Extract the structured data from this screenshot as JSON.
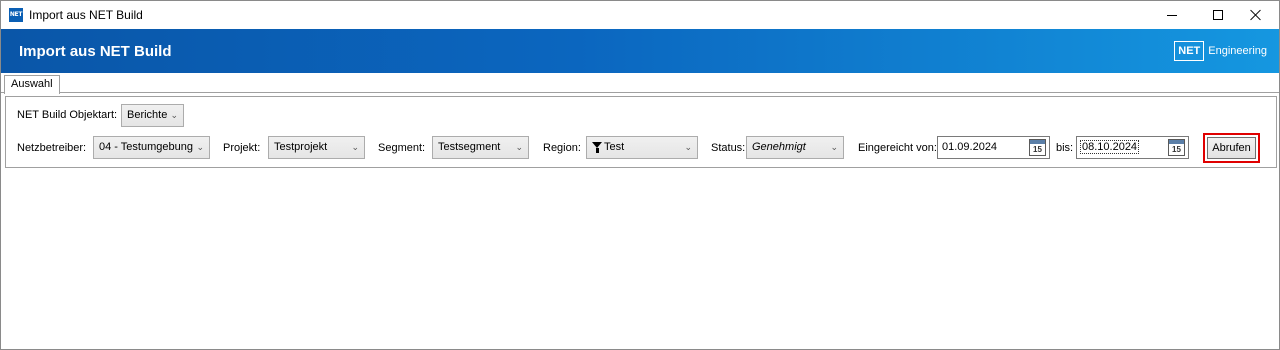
{
  "window": {
    "title": "Import aus NET Build",
    "icon_text": "NET"
  },
  "banner": {
    "title": "Import aus NET Build",
    "brand_logo": "NET",
    "brand_text": "Engineering"
  },
  "tabs": [
    {
      "label": "Auswahl"
    }
  ],
  "form": {
    "objektart": {
      "label": "NET Build Objektart:",
      "value": "Berichte"
    },
    "netzbetreiber": {
      "label": "Netzbetreiber:",
      "value": "04 - Testumgebung"
    },
    "projekt": {
      "label": "Projekt:",
      "value": "Testprojekt"
    },
    "segment": {
      "label": "Segment:",
      "value": "Testsegment"
    },
    "region": {
      "label": "Region:",
      "value": "Test"
    },
    "status": {
      "label": "Status:",
      "value": "Genehmigt"
    },
    "eingereicht_von": {
      "label": "Eingereicht von:",
      "value": "01.09.2024",
      "cal_number": "15"
    },
    "bis": {
      "label": "bis:",
      "value": "08.10.2024",
      "cal_number": "15"
    },
    "abrufen_label": "Abrufen"
  },
  "colors": {
    "banner_start": "#0a56a8",
    "banner_end": "#1597e0",
    "highlight": "#e00000"
  },
  "icons": {
    "chevron": "chevron-down-icon",
    "filter": "filter-icon",
    "calendar": "calendar-icon"
  }
}
